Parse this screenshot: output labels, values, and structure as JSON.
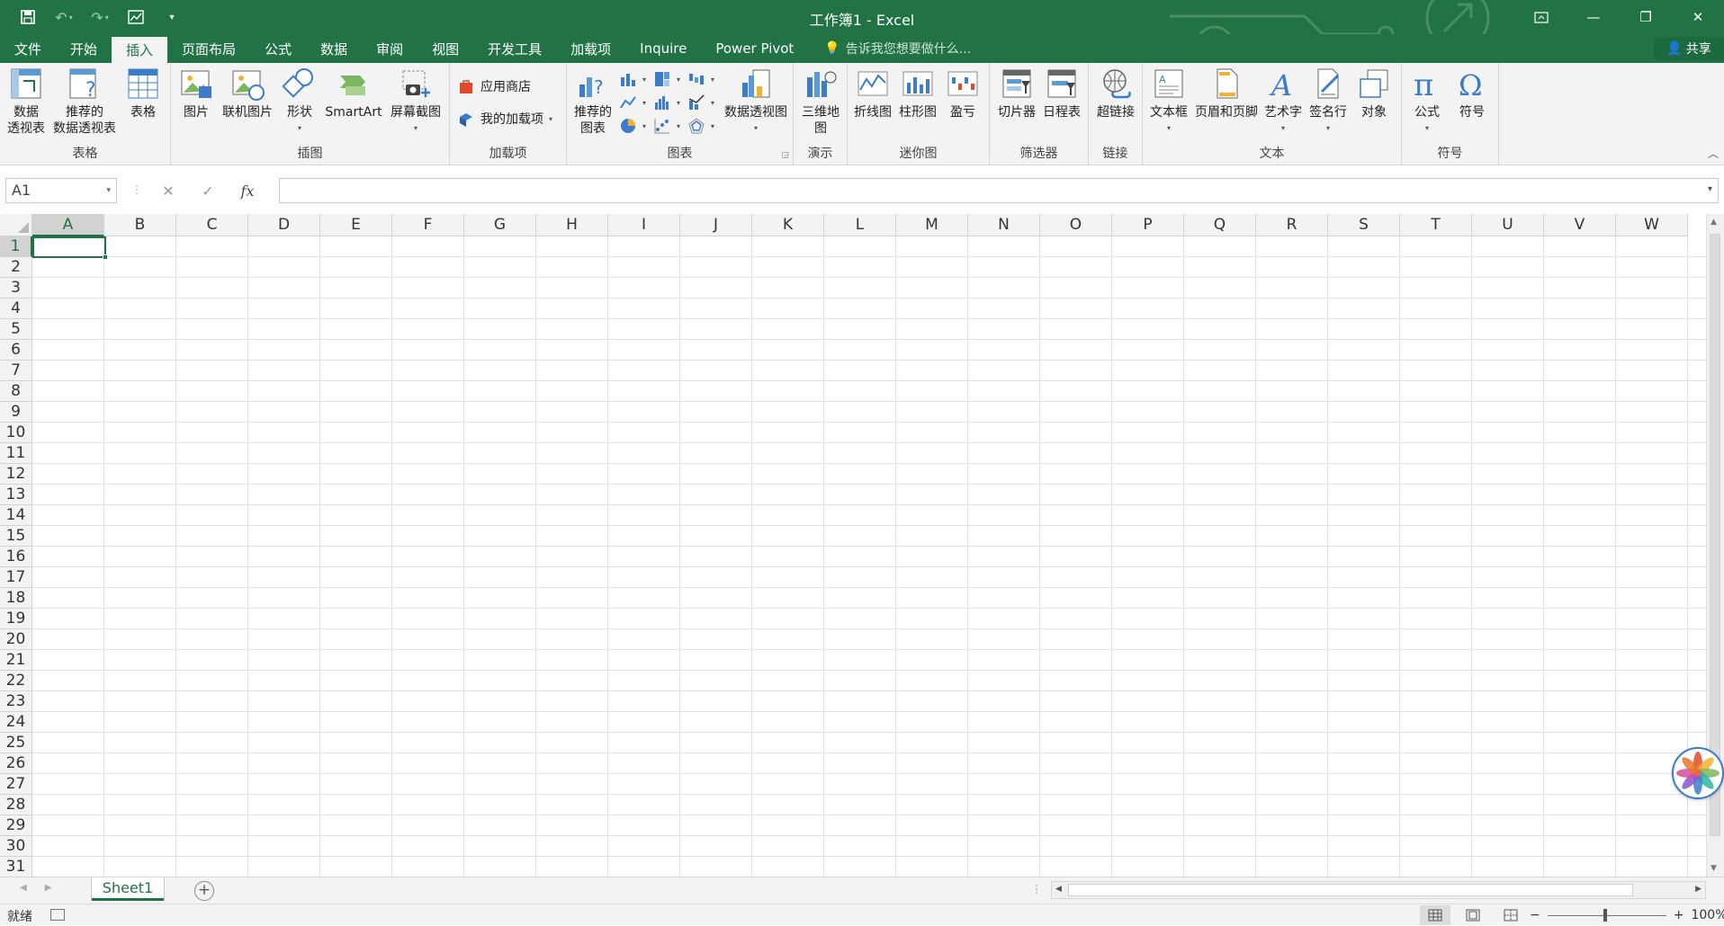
{
  "title_bar": {
    "document_title": "工作簿1 - Excel",
    "qat_icons": [
      "save-icon",
      "undo-icon",
      "redo-icon",
      "customize-icon"
    ],
    "window_icons": [
      "ribbon-display-icon",
      "minimize-icon",
      "restore-icon",
      "close-icon"
    ]
  },
  "tabs": [
    "文件",
    "开始",
    "插入",
    "页面布局",
    "公式",
    "数据",
    "审阅",
    "视图",
    "开发工具",
    "加载项",
    "Inquire",
    "Power Pivot"
  ],
  "active_tab": "插入",
  "tell_me": "告诉我您想要做什么...",
  "share": "共享",
  "ribbon": {
    "groups": {
      "tables": "表格",
      "illustrations": "插图",
      "addins": "加载项",
      "charts": "图表",
      "tours": "演示",
      "sparklines": "迷你图",
      "filters": "筛选器",
      "links": "链接",
      "text": "文本",
      "symbols": "符号"
    },
    "buttons": {
      "pivot_table_1": "数据",
      "pivot_table_2": "透视表",
      "recommended_pivot_1": "推荐的",
      "recommended_pivot_2": "数据透视表",
      "table": "表格",
      "pictures": "图片",
      "online_pictures": "联机图片",
      "shapes": "形状",
      "smartart": "SmartArt",
      "screenshot": "屏幕截图",
      "store": "应用商店",
      "my_addins": "我的加载项",
      "recommended_charts_1": "推荐的",
      "recommended_charts_2": "图表",
      "pivot_chart": "数据透视图",
      "map_3d_1": "三维地",
      "map_3d_2": "图",
      "spark_line": "折线图",
      "spark_column": "柱形图",
      "spark_winloss": "盈亏",
      "slicer": "切片器",
      "timeline": "日程表",
      "hyperlink": "超链接",
      "textbox": "文本框",
      "header_footer": "页眉和页脚",
      "wordart": "艺术字",
      "signature": "签名行",
      "object": "对象",
      "equation": "公式",
      "symbol": "符号"
    }
  },
  "formula_bar": {
    "name_box": "A1",
    "fx_label": "fx",
    "formula_value": ""
  },
  "grid": {
    "columns": [
      "A",
      "B",
      "C",
      "D",
      "E",
      "F",
      "G",
      "H",
      "I",
      "J",
      "K",
      "L",
      "M",
      "N",
      "O",
      "P",
      "Q",
      "R",
      "S",
      "T",
      "U",
      "V",
      "W"
    ],
    "rows": [
      "1",
      "2",
      "3",
      "4",
      "5",
      "6",
      "7",
      "8",
      "9",
      "10",
      "11",
      "12",
      "13",
      "14",
      "15",
      "16",
      "17",
      "18",
      "19",
      "20",
      "21",
      "22",
      "23",
      "24",
      "25",
      "26",
      "27",
      "28",
      "29",
      "30",
      "31"
    ],
    "active_cell": "A1"
  },
  "sheet_tabs": [
    "Sheet1"
  ],
  "status_bar": {
    "status": "就绪",
    "zoom": "100%"
  },
  "colors": {
    "brand": "#217346",
    "ribbon_bg": "#f3f3f3",
    "gridline": "#e1e1e1"
  }
}
